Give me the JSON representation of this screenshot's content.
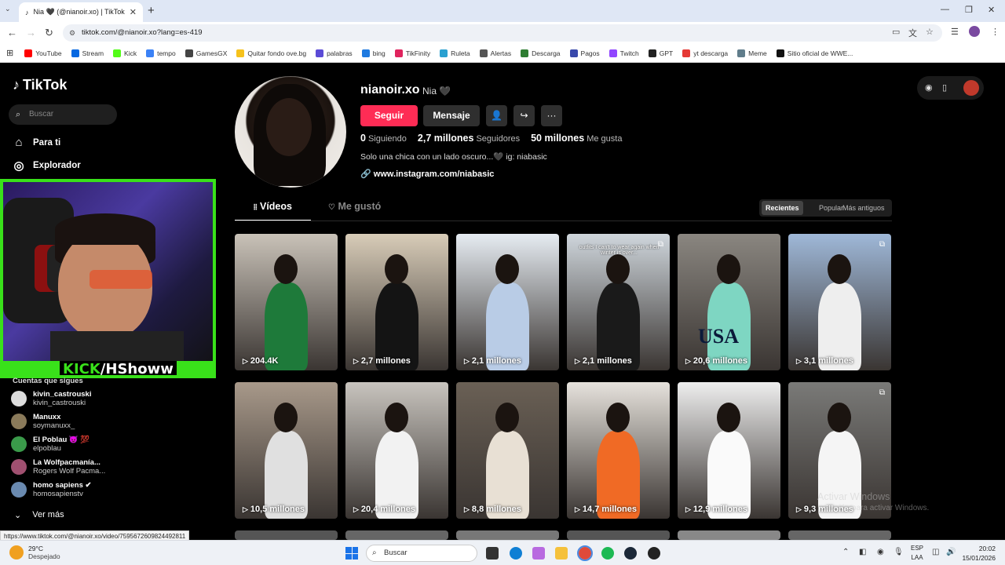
{
  "browser": {
    "tab_title": "Nia 🖤 (@nianoir.xo) | TikTok",
    "url": "tiktok.com/@nianoir.xo?lang=es-419",
    "bookmarks": [
      {
        "label": "YouTube",
        "color": "#ff0000"
      },
      {
        "label": "Stream",
        "color": "#0668e1"
      },
      {
        "label": "Kick",
        "color": "#53fc18"
      },
      {
        "label": "tempo",
        "color": "#3b82f6"
      },
      {
        "label": "GamesGX",
        "color": "#444444"
      },
      {
        "label": "Quitar fondo ove.bg",
        "color": "#f6c21c"
      },
      {
        "label": "palabras",
        "color": "#5b4bd6"
      },
      {
        "label": "bing",
        "color": "#1f7ae0"
      },
      {
        "label": "TikFinity",
        "color": "#e0245e"
      },
      {
        "label": "Ruleta",
        "color": "#2aa0d0"
      },
      {
        "label": "Alertas",
        "color": "#555555"
      },
      {
        "label": "Descarga",
        "color": "#2e7d32"
      },
      {
        "label": "Pagos",
        "color": "#3949ab"
      },
      {
        "label": "Twitch",
        "color": "#9146ff"
      },
      {
        "label": "GPT",
        "color": "#222222"
      },
      {
        "label": "yt descarga",
        "color": "#e53935"
      },
      {
        "label": "Meme",
        "color": "#607d8b"
      },
      {
        "label": "Sitio oficial de WWE...",
        "color": "#111111"
      }
    ]
  },
  "sidebar": {
    "logo": "TikTok",
    "search_placeholder": "Buscar",
    "nav": [
      {
        "label": "Para ti",
        "icon": "home-icon"
      },
      {
        "label": "Explorador",
        "icon": "compass-icon"
      }
    ],
    "overlay_text_kick": "KICK",
    "overlay_text_handle": "/HShoww",
    "follows_title": "Cuentas que sigues",
    "following": [
      {
        "name": "kivin_castrouski",
        "handle": "kivin_castrouski",
        "color": "#dddddd"
      },
      {
        "name": "Manuxx",
        "handle": "soymanuxx_",
        "color": "#8a7a5a"
      },
      {
        "name": "El Poblau 😈 💯",
        "handle": "elpoblau",
        "color": "#3a9a4a"
      },
      {
        "name": "La Wolfpacmanía...",
        "handle": "Rogers Wolf Pacma...",
        "color": "#a05070"
      },
      {
        "name": "homo sapiens ✔",
        "handle": "homosapienstv",
        "color": "#6a8ab0"
      }
    ],
    "see_more": "Ver más"
  },
  "profile": {
    "username": "nianoir.xo",
    "nickname": "Nia 🖤",
    "follow_label": "Seguir",
    "message_label": "Mensaje",
    "following_count": "0",
    "following_label": "Siguiendo",
    "followers_count": "2,7 millones",
    "followers_label": "Seguidores",
    "likes_count": "50 millones",
    "likes_label": "Me gusta",
    "bio": "Solo una chica con un lado oscuro...🖤 ig: niabasic",
    "link": "www.instagram.com/niabasic"
  },
  "tabs": {
    "videos": "Vídeos",
    "liked": "Me gustó"
  },
  "sort": {
    "recent": "Recientes",
    "popular": "Popular",
    "oldest": "Más antiguos"
  },
  "videos": [
    {
      "views": "204.4K",
      "bg": "#c9c2b8",
      "outfit": "#1e7a3a",
      "multi": false,
      "caption": ""
    },
    {
      "views": "2,7 millones",
      "bg": "#d8ccb8",
      "outfit": "#141414",
      "multi": false,
      "caption": ""
    },
    {
      "views": "2,1 millones",
      "bg": "#e6ecf2",
      "outfit": "#b9cce6",
      "multi": false,
      "caption": ""
    },
    {
      "views": "2,1 millones",
      "bg": "#cfd6dc",
      "outfit": "#1a1a1a",
      "multi": true,
      "caption": "outfits I can't to wear again when winter is over..."
    },
    {
      "views": "20,6 millones",
      "bg": "#8a8680",
      "outfit": "#7ed6c2",
      "multi": false,
      "caption": ""
    },
    {
      "views": "3,1 millones",
      "bg": "#9fb8d8",
      "outfit": "#eeeeee",
      "multi": true,
      "caption": ""
    },
    {
      "views": "10,5 millones",
      "bg": "#a8998a",
      "outfit": "#e0e0e0",
      "multi": false,
      "caption": ""
    },
    {
      "views": "20,4 millones",
      "bg": "#c8c4be",
      "outfit": "#f2f2f2",
      "multi": false,
      "caption": ""
    },
    {
      "views": "8,8 millones",
      "bg": "#6a6055",
      "outfit": "#e8e0d4",
      "multi": false,
      "caption": ""
    },
    {
      "views": "14,7 millones",
      "bg": "#e6e2dc",
      "outfit": "#f06a25",
      "multi": false,
      "caption": ""
    },
    {
      "views": "12,9 millones",
      "bg": "#eeeeee",
      "outfit": "#fafafa",
      "multi": false,
      "caption": ""
    },
    {
      "views": "9,3 millones",
      "bg": "#7a7a78",
      "outfit": "#f5f5f5",
      "multi": true,
      "caption": ""
    }
  ],
  "windows": {
    "activate_title": "Activar Windows",
    "activate_sub": "...uración para activar Windows.",
    "status_url": "https://www.tiktok.com/@nianoir.xo/video/7595672609824492811"
  },
  "taskbar": {
    "temp": "29°C",
    "weather": "Despejado",
    "search": "Buscar",
    "lang1": "ESP",
    "lang2": "LAA",
    "time": "20:02",
    "date": "15/01/2026"
  }
}
